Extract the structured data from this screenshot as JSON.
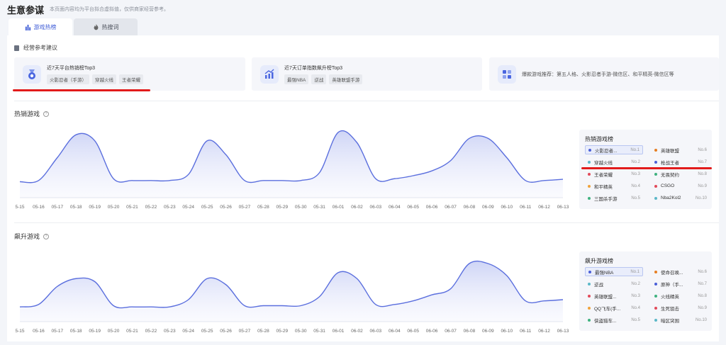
{
  "header": {
    "title": "生意参谋",
    "subtitle": "本页面内容均为平台拟合虚拟值，仅供商家经营参考。"
  },
  "tabs": [
    {
      "label": "游戏热榜",
      "active": true,
      "icon": "bar-chart-icon"
    },
    {
      "label": "热搜词",
      "active": false,
      "icon": "fire-icon"
    }
  ],
  "advice": {
    "title": "经营参考建议",
    "cards": [
      {
        "title": "近7天平台热销榜Top3",
        "tags": [
          "火影忍者（手游）",
          "穿越火线",
          "王者荣耀"
        ],
        "icon": "medal-icon"
      },
      {
        "title": "近7天订单指数飙升榜Top3",
        "tags": [
          "最强NBA",
          "逆战",
          "英雄联盟手游"
        ],
        "icon": "trend-up-icon"
      },
      {
        "text": "爆款游戏推荐：第五人格、火影忍者手游-微信区、和平精英-微信区等",
        "icon": "apps-icon"
      }
    ]
  },
  "hot": {
    "title": "热销游戏",
    "ranking": {
      "title": "热销游戏榜",
      "left": [
        {
          "name": "火影忍者...",
          "no": "No.1",
          "color": "#4a5fd8",
          "selected": true
        },
        {
          "name": "穿越火线",
          "no": "No.2",
          "color": "#5bb8c8"
        },
        {
          "name": "王者荣耀",
          "no": "No.3",
          "color": "#e24a5a"
        },
        {
          "name": "和平精英",
          "no": "No.4",
          "color": "#f0a23b"
        },
        {
          "name": "三国杀手游",
          "no": "No.5",
          "color": "#3fb27f"
        }
      ],
      "right": [
        {
          "name": "英雄联盟",
          "no": "No.6",
          "color": "#e67e22"
        },
        {
          "name": "枪战王者",
          "no": "No.7",
          "color": "#4a5fd8"
        },
        {
          "name": "无畏契约",
          "no": "No.8",
          "color": "#3fb27f"
        },
        {
          "name": "CSGO",
          "no": "No.9",
          "color": "#e24a5a"
        },
        {
          "name": "Nba2Kol2",
          "no": "No.10",
          "color": "#5bb8c8"
        }
      ]
    }
  },
  "rise": {
    "title": "飙升游戏",
    "ranking": {
      "title": "飙升游戏榜",
      "left": [
        {
          "name": "最强NBA",
          "no": "No.1",
          "color": "#4a5fd8",
          "selected": true
        },
        {
          "name": "逆战",
          "no": "No.2",
          "color": "#5bb8c8"
        },
        {
          "name": "英雄联盟...",
          "no": "No.3",
          "color": "#e24a5a"
        },
        {
          "name": "QQ飞车(手...",
          "no": "No.4",
          "color": "#f0a23b"
        },
        {
          "name": "侠盗猎车...",
          "no": "No.5",
          "color": "#3fb27f"
        }
      ],
      "right": [
        {
          "name": "使命召唤...",
          "no": "No.6",
          "color": "#e67e22"
        },
        {
          "name": "原神（手...",
          "no": "No.7",
          "color": "#4a5fd8"
        },
        {
          "name": "火线精英",
          "no": "No.8",
          "color": "#3fb27f"
        },
        {
          "name": "生死狙击",
          "no": "No.9",
          "color": "#e24a5a"
        },
        {
          "name": "暗区突围",
          "no": "No.10",
          "color": "#5bb8c8"
        }
      ]
    }
  },
  "chart_data": [
    {
      "type": "area",
      "categories": [
        "5-15",
        "05-16",
        "05-17",
        "05-18",
        "05-19",
        "05-20",
        "05-21",
        "05-22",
        "05-23",
        "05-24",
        "05-25",
        "05-26",
        "05-27",
        "05-28",
        "05-29",
        "05-30",
        "05-31",
        "06-01",
        "06-02",
        "06-03",
        "06-04",
        "06-05",
        "06-06",
        "06-07",
        "06-08",
        "06-09",
        "06-10",
        "06-11",
        "06-12",
        "06-13"
      ],
      "values": [
        0.1,
        0.12,
        0.5,
        0.88,
        0.78,
        0.15,
        0.12,
        0.12,
        0.12,
        0.22,
        0.78,
        0.55,
        0.12,
        0.12,
        0.12,
        0.12,
        0.25,
        0.92,
        0.75,
        0.15,
        0.15,
        0.2,
        0.28,
        0.45,
        0.82,
        0.82,
        0.5,
        0.12,
        0.12,
        0.14
      ],
      "color": "#5b6fde",
      "grid": false
    },
    {
      "type": "area",
      "categories": [
        "5-15",
        "05-16",
        "05-17",
        "05-18",
        "05-19",
        "05-20",
        "05-21",
        "05-22",
        "05-23",
        "05-24",
        "05-25",
        "05-26",
        "05-27",
        "05-28",
        "05-29",
        "05-30",
        "05-31",
        "06-01",
        "06-02",
        "06-03",
        "06-04",
        "06-05",
        "06-06",
        "06-07",
        "06-08",
        "06-09",
        "06-10",
        "06-11",
        "06-12",
        "06-13"
      ],
      "values": [
        0.08,
        0.12,
        0.42,
        0.55,
        0.5,
        0.1,
        0.08,
        0.08,
        0.08,
        0.2,
        0.55,
        0.45,
        0.1,
        0.1,
        0.1,
        0.1,
        0.25,
        0.65,
        0.55,
        0.12,
        0.12,
        0.18,
        0.28,
        0.38,
        0.8,
        0.8,
        0.6,
        0.18,
        0.18,
        0.2
      ],
      "color": "#5b6fde",
      "grid": false
    }
  ]
}
